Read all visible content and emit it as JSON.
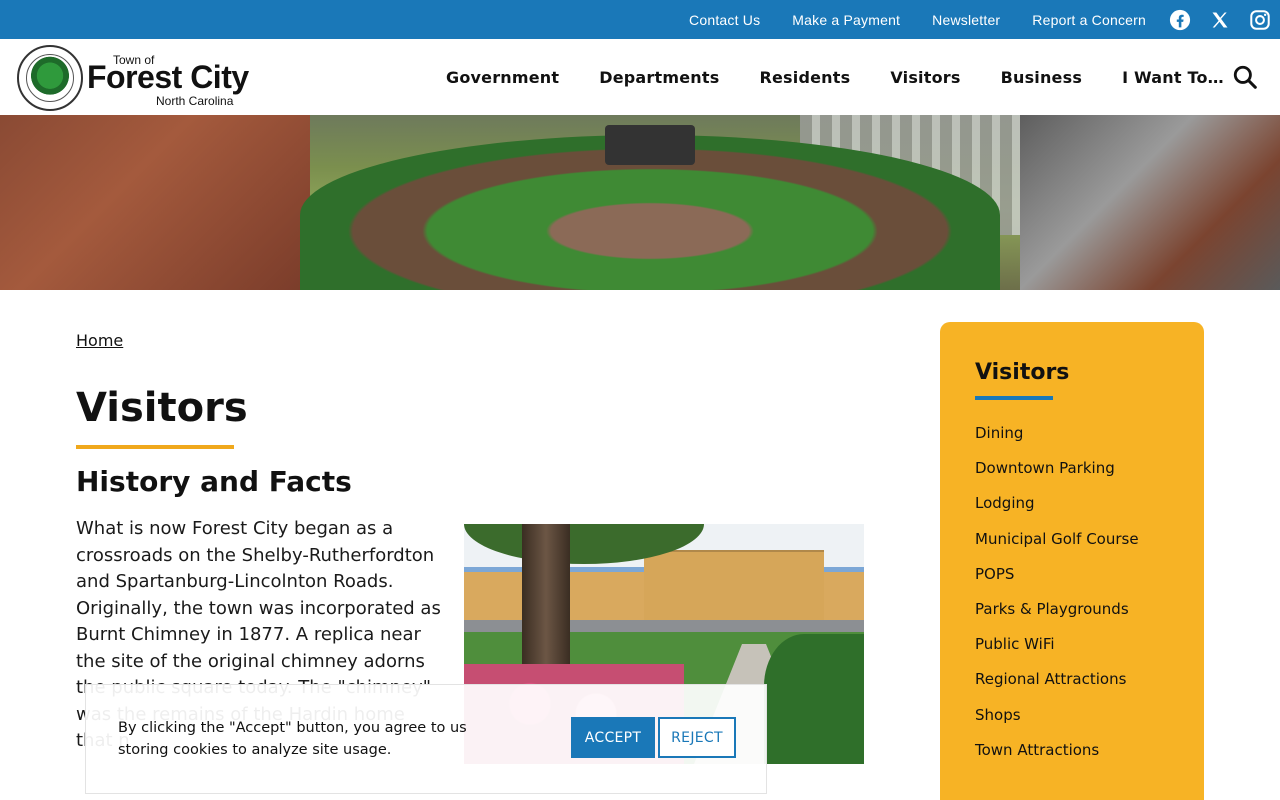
{
  "topbar": {
    "links": [
      "Contact Us",
      "Make a Payment",
      "Newsletter",
      "Report a Concern"
    ],
    "social_icons": [
      "facebook-icon",
      "x-icon",
      "instagram-icon"
    ],
    "color": "#1a78b8"
  },
  "logo": {
    "small_text": "Town of",
    "name": "Forest City",
    "sub_text": "North Carolina"
  },
  "nav": {
    "items": [
      "Government",
      "Departments",
      "Residents",
      "Visitors",
      "Business",
      "I Want To…"
    ],
    "search_icon": "search-icon"
  },
  "breadcrumb": {
    "home": "Home"
  },
  "page": {
    "title": "Visitors",
    "subtitle": "History and Facts",
    "body": "What is now Forest City began as a crossroads on the Shelby-Rutherfordton and Spartanburg-Lincolnton Roads. Originally, the town was incorporated as Burnt Chimney in 1877. A replica near the site of the original chimney adorns the public square today. The \"chimney\" was the remains of the Hardin home that n",
    "accent": "#f0a81c"
  },
  "sidebar": {
    "title": "Visitors",
    "items": [
      "Dining",
      "Downtown Parking",
      "Lodging",
      "Municipal Golf Course",
      "POPS",
      "Parks & Playgrounds",
      "Public WiFi",
      "Regional Attractions",
      "Shops",
      "Town Attractions"
    ],
    "background": "#f7b325"
  },
  "cookie": {
    "text": "By clicking the \"Accept\" button, you agree to us storing cookies to analyze site usage.",
    "accept": "ACCEPT",
    "reject": "REJECT"
  }
}
